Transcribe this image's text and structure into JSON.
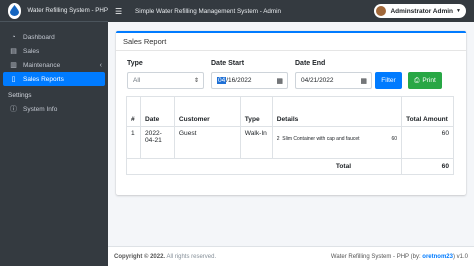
{
  "brand": {
    "title": "Water Refilling System - PHP"
  },
  "topbar": {
    "title": "Simple Water Refilling Management System - Admin",
    "user": "Adminstrator Admin"
  },
  "sidebar": {
    "items": [
      {
        "label": "Dashboard",
        "icon": "dashboard-icon"
      },
      {
        "label": "Sales",
        "icon": "document-icon"
      },
      {
        "label": "Maintenance",
        "icon": "database-icon"
      },
      {
        "label": "Sales Reports",
        "icon": "file-icon"
      }
    ],
    "section": "Settings",
    "settings_items": [
      {
        "label": "System Info",
        "icon": "info-icon"
      }
    ]
  },
  "card": {
    "title": "Sales Report",
    "type_label": "Type",
    "type_value": "All",
    "start_label": "Date Start",
    "start_month": "04",
    "start_rest": "/16/2022",
    "end_label": "Date End",
    "end_value": "04/21/2022",
    "filter_label": "Filter",
    "print_label": "Print"
  },
  "table": {
    "headers": [
      "#",
      "Date",
      "Customer",
      "Type",
      "Details",
      "Total Amount"
    ],
    "rows": [
      {
        "num": "1",
        "date": "2022-04-21",
        "customer": "Guest",
        "type": "Walk-In",
        "qty": "2",
        "item": "Slim Container with cap and faucet",
        "price": "60",
        "total": "60"
      }
    ],
    "total_label": "Total",
    "total_value": "60"
  },
  "footer": {
    "copy_prefix": "Copyright © 2022.",
    "copy_suffix": "All rights reserved.",
    "credit": "Water Refilling System - PHP (by:",
    "author": "oretnom23",
    "version": ") v1.0"
  }
}
